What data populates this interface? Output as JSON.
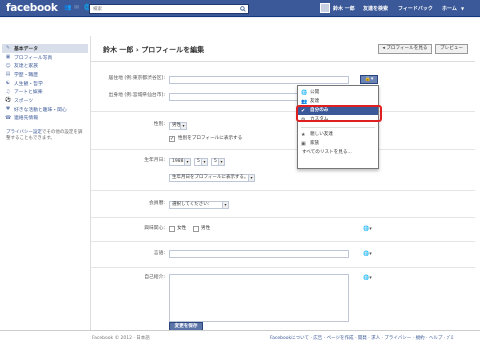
{
  "top": {
    "logo": "facebook",
    "search_placeholder": "検索",
    "user_name": "鈴木 一郎",
    "find_friends": "友達を検索",
    "feedback": "フィードバック",
    "home": "ホーム"
  },
  "sidebar": {
    "items": [
      {
        "label": "基本データ",
        "icon": "pencil-icon"
      },
      {
        "label": "プロフィール写真",
        "icon": "photo-icon"
      },
      {
        "label": "友達と家族",
        "icon": "people-icon"
      },
      {
        "label": "学歴・職歴",
        "icon": "school-icon"
      },
      {
        "label": "人生観・哲学",
        "icon": "philosophy-icon"
      },
      {
        "label": "アートと娯楽",
        "icon": "art-icon"
      },
      {
        "label": "スポーツ",
        "icon": "sports-icon"
      },
      {
        "label": "好きな活動と趣味・関心",
        "icon": "hobby-icon"
      },
      {
        "label": "連絡先情報",
        "icon": "contact-icon"
      }
    ],
    "note_link": "プライバシー設定",
    "note_text": "でその他の設定を調整することもできます。"
  },
  "header": {
    "title_name": "鈴木 一郎",
    "title_sep": "›",
    "title_page": "プロフィールを編集",
    "view_profile": "◂ プロフィールを見る",
    "preview": "プレビュー"
  },
  "form": {
    "current_city_label": "居住地 (例:東京都渋谷区):",
    "hometown_label": "出身地 (例:宮城県仙台市):",
    "gender_label": "性別:",
    "gender_value": "男性",
    "show_gender": "性別をプロフィールに表示する",
    "birthday_label": "生年月日:",
    "birth_year": "1988",
    "birth_month": "5",
    "birth_day": "5",
    "birthday_visibility": "生年月日をプロフィールに表示する。",
    "interested_label": "会員暦:",
    "interested_value": "選択してください:",
    "interested_in_label": "興味関心:",
    "female": "女性",
    "male": "男性",
    "languages_label": "言語:",
    "about_label": "自己紹介:",
    "save": "変更を保存"
  },
  "privacy_menu": {
    "public": "公開",
    "friends": "友達",
    "only_me": "自分のみ",
    "custom": "カスタム",
    "close_friends": "親しい友達",
    "family": "家族",
    "see_all": "すべてのリストを見る..."
  },
  "footer": {
    "copyright": "Facebook © 2012 · 日本語",
    "links": "Facebookについて · 広告 · ページを作成 · 開発 · 求人 · プライバシー · 規約 · ヘルプ · ﾌﾞﾛ"
  },
  "colors": {
    "brand": "#3b5998",
    "highlight": "#e02020"
  }
}
